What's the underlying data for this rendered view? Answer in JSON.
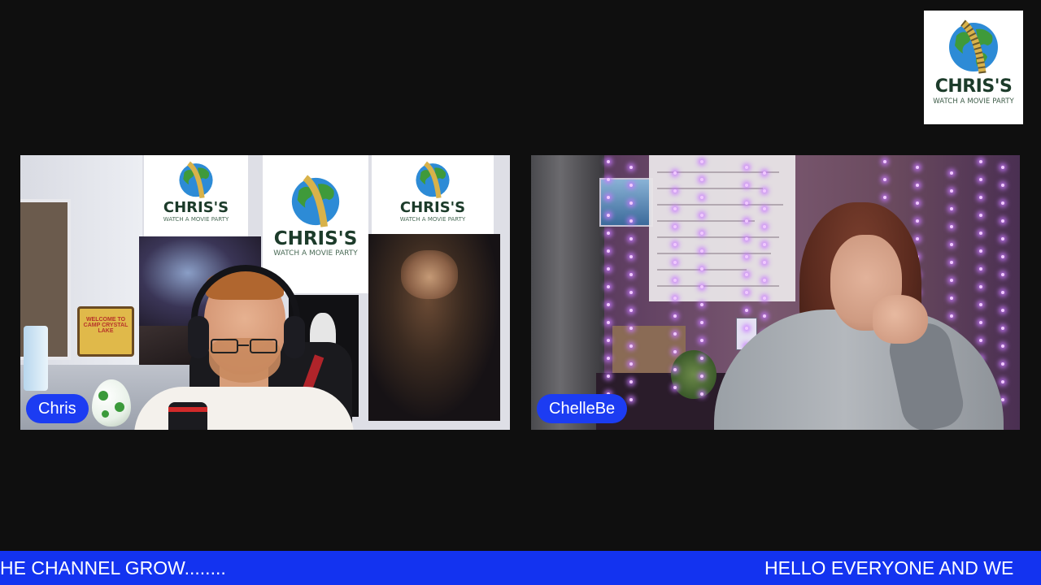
{
  "logo": {
    "title": "CHRIS'S",
    "subtitle": "WATCH A MOVIE PARTY",
    "icon": "globe-film-reel-icon"
  },
  "participants": [
    {
      "name": "Chris"
    },
    {
      "name": "ChelleBe"
    }
  ],
  "background": {
    "banner_title": "CHRIS'S",
    "banner_subtitle": "WATCH A MOVIE PARTY",
    "sign_text": "WELCOME TO CAMP CRYSTAL LAKE"
  },
  "ticker": {
    "segment_left": "HE CHANNEL GROW........",
    "segment_right": "HELLO EVERYONE AND WE"
  },
  "colors": {
    "accent": "#1c3cf2",
    "ticker_bg": "#1333f0",
    "background": "#0f0f0f"
  }
}
